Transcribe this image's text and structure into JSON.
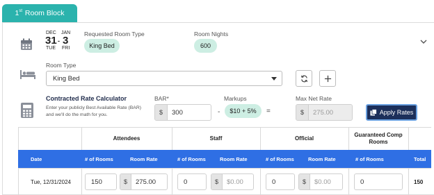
{
  "tab": {
    "ordinal_num": "1",
    "ordinal_suffix": "st",
    "label": "Room Block"
  },
  "summary": {
    "date": {
      "month_start": "DEC",
      "month_end": "JAN",
      "day_start": "31",
      "day_end": "3",
      "dow_start": "TUE",
      "dow_end": "FRI",
      "separator": "-"
    },
    "requested_room_type_label": "Requested Room Type",
    "requested_room_type_value": "King Bed",
    "room_nights_label": "Room Nights",
    "room_nights_value": "600"
  },
  "room_type": {
    "label": "Room Type",
    "selected": "King Bed"
  },
  "calculator": {
    "title": "Contracted Rate Calculator",
    "description": "Enter your publicly Best Available Rate (BAR) and we'll do the math for you.",
    "bar_label": "BAR*",
    "bar_currency": "$",
    "bar_value": "300",
    "minus": "-",
    "markups_label": "Markups",
    "markups_value": "$10 + 5%",
    "equals": "=",
    "max_net_rate_label": "Max Net Rate",
    "max_net_rate_currency": "$",
    "max_net_rate_value": "275.00",
    "apply_label": "Apply Rates"
  },
  "table": {
    "groups": [
      "Attendees",
      "Staff",
      "Official",
      "Guaranteed Comp Rooms"
    ],
    "headers": {
      "date": "Date",
      "rooms": "# of Rooms",
      "rate": "Room Rate",
      "total": "Total"
    },
    "row": {
      "date": "Tue, 12/31/2024",
      "attendees_rooms": "150",
      "attendees_currency": "$",
      "attendees_rate": "275.00",
      "staff_rooms": "0",
      "staff_currency": "$",
      "staff_rate": "$0.00",
      "official_rooms": "0",
      "official_currency": "$",
      "official_rate": "$0.00",
      "comp_rooms": "0",
      "total": "150"
    }
  },
  "colors": {
    "teal": "#2bb3ad",
    "mint": "#cdeee3",
    "blue": "#2f6fe4",
    "navy": "#1c2f5a"
  },
  "icons": [
    "calendar-icon",
    "bed-icon",
    "calculator-icon",
    "chevron-down-icon",
    "refresh-icon",
    "plus-icon",
    "copy-icon"
  ]
}
